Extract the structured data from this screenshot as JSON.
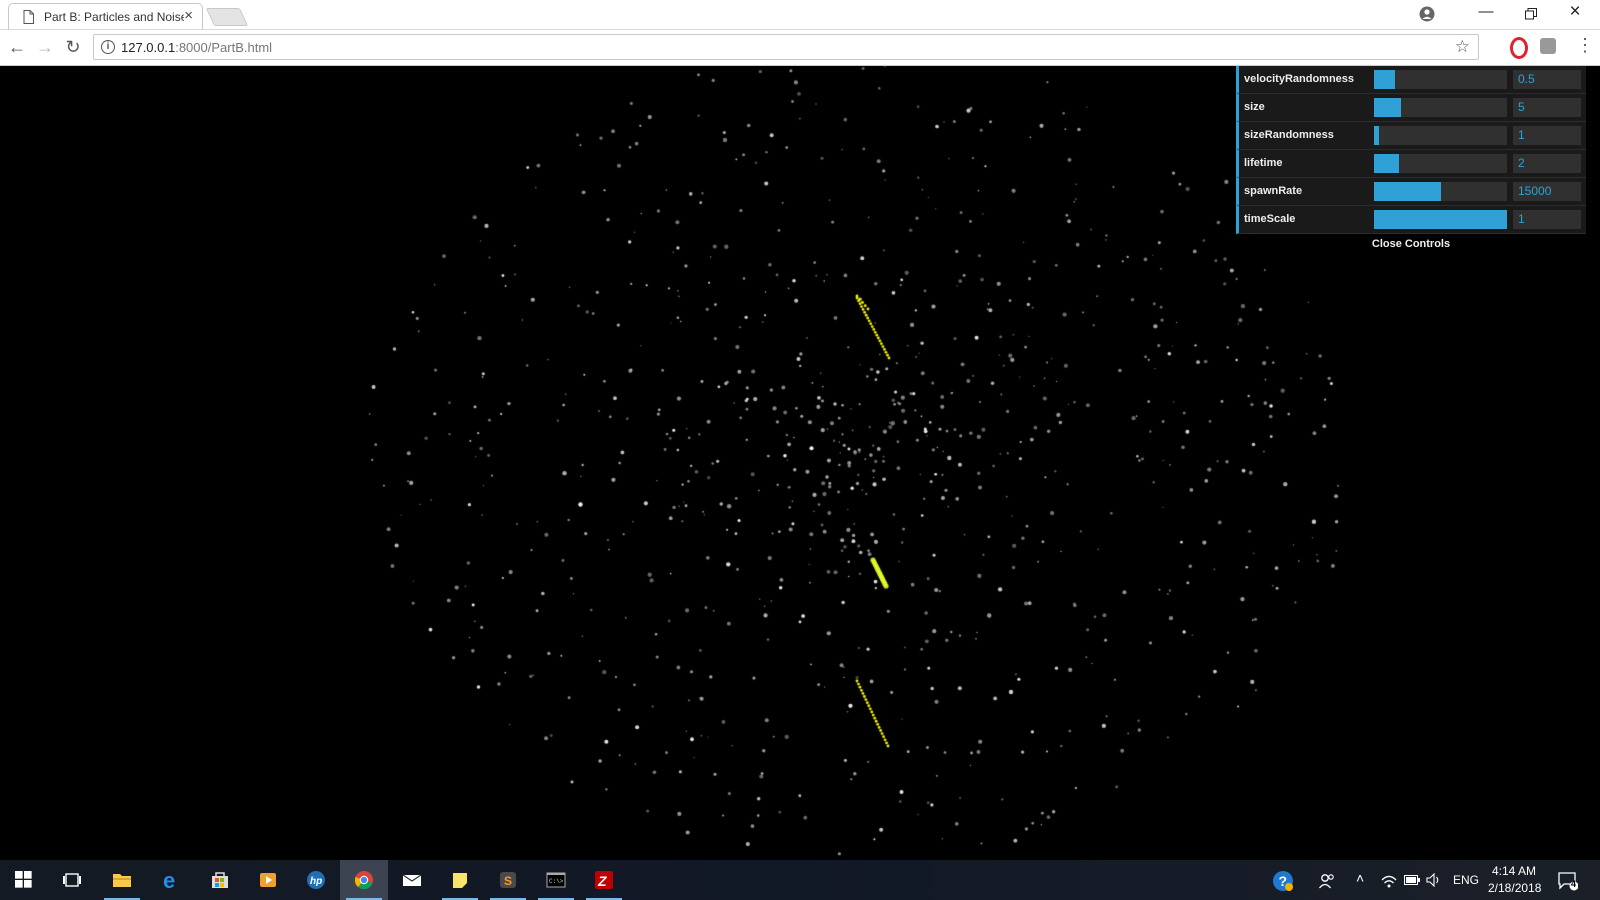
{
  "browser": {
    "tab_title": "Part B: Particles and Noise",
    "tab_close": "×",
    "url_host": "127.0.0.1",
    "url_rest": ":8000/PartB.html",
    "window_controls": [
      "account-icon",
      "minimize-icon",
      "restore-icon",
      "close-icon"
    ]
  },
  "gui": {
    "controls": [
      {
        "label": "velocityRandomness",
        "value": "0.5",
        "level": 0.16
      },
      {
        "label": "size",
        "value": "5",
        "level": 0.2
      },
      {
        "label": "sizeRandomness",
        "value": "1",
        "level": 0.04
      },
      {
        "label": "lifetime",
        "value": "2",
        "level": 0.19
      },
      {
        "label": "spawnRate",
        "value": "15000",
        "level": 0.5
      },
      {
        "label": "timeScale",
        "value": "1",
        "level": 1.0
      }
    ],
    "close_label": "Close Controls",
    "accent": "#2fa1d6"
  },
  "taskbar": {
    "apps": [
      "windows-start-icon",
      "task-view-icon",
      "file-explorer-icon",
      "edge-icon",
      "store-icon",
      "media-player-icon",
      "hp-icon",
      "chrome-icon",
      "mail-icon",
      "sticky-notes-icon",
      "sublime-text-icon",
      "command-prompt-icon",
      "filezilla-icon"
    ],
    "language": "ENG",
    "time": "4:14 AM",
    "date": "2/18/2018",
    "notification_count": "4"
  }
}
